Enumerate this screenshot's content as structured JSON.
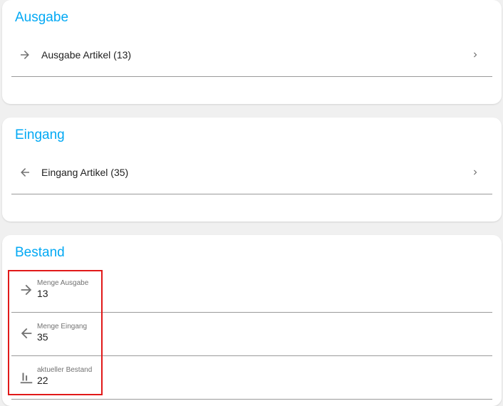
{
  "cards": {
    "ausgabe": {
      "title": "Ausgabe",
      "link_label": "Ausgabe Artikel (13)",
      "icon": "arrow-right-icon"
    },
    "eingang": {
      "title": "Eingang",
      "link_label": "Eingang Artikel (35)",
      "icon": "arrow-left-icon"
    },
    "bestand": {
      "title": "Bestand",
      "rows": [
        {
          "caption": "Menge Ausgabe",
          "value": "13",
          "icon": "arrow-right-icon"
        },
        {
          "caption": "Menge Eingang",
          "value": "35",
          "icon": "arrow-left-icon"
        },
        {
          "caption": "aktueller Bestand",
          "value": "22",
          "icon": "bar-chart-icon"
        }
      ]
    }
  },
  "colors": {
    "accent": "#03a9f4",
    "highlight": "#e11919",
    "background": "#f0f0f0"
  }
}
